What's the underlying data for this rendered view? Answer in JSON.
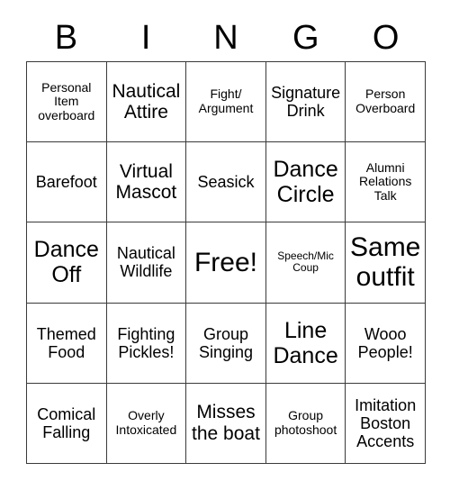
{
  "header": {
    "letters": [
      "B",
      "I",
      "N",
      "G",
      "O"
    ]
  },
  "grid": {
    "rows": 5,
    "columns": 5,
    "cells": [
      {
        "text": "Personal Item overboard",
        "size": "t-sm",
        "name": "bingo-cell-b1"
      },
      {
        "text": "Nautical Attire",
        "size": "t-lg",
        "name": "bingo-cell-i1"
      },
      {
        "text": "Fight/ Argument",
        "size": "t-sm",
        "name": "bingo-cell-n1"
      },
      {
        "text": "Signature Drink",
        "size": "t-md",
        "name": "bingo-cell-g1"
      },
      {
        "text": "Person Overboard",
        "size": "t-sm",
        "name": "bingo-cell-o1"
      },
      {
        "text": "Barefoot",
        "size": "t-md",
        "name": "bingo-cell-b2"
      },
      {
        "text": "Virtual Mascot",
        "size": "t-lg",
        "name": "bingo-cell-i2"
      },
      {
        "text": "Seasick",
        "size": "t-md",
        "name": "bingo-cell-n2"
      },
      {
        "text": "Dance Circle",
        "size": "t-xl",
        "name": "bingo-cell-g2"
      },
      {
        "text": "Alumni Relations Talk",
        "size": "t-sm",
        "name": "bingo-cell-o2"
      },
      {
        "text": "Dance Off",
        "size": "t-xl",
        "name": "bingo-cell-b3"
      },
      {
        "text": "Nautical Wildlife",
        "size": "t-md",
        "name": "bingo-cell-i3"
      },
      {
        "text": "Free!",
        "size": "t-xxl",
        "name": "bingo-cell-free-space"
      },
      {
        "text": "Speech/Mic Coup",
        "size": "t-xs",
        "name": "bingo-cell-g3"
      },
      {
        "text": "Same outfit",
        "size": "t-xxl",
        "name": "bingo-cell-o3"
      },
      {
        "text": "Themed Food",
        "size": "t-md",
        "name": "bingo-cell-b4"
      },
      {
        "text": "Fighting Pickles!",
        "size": "t-md",
        "name": "bingo-cell-i4"
      },
      {
        "text": "Group Singing",
        "size": "t-md",
        "name": "bingo-cell-n4"
      },
      {
        "text": "Line Dance",
        "size": "t-xl",
        "name": "bingo-cell-g4"
      },
      {
        "text": "Wooo People!",
        "size": "t-md",
        "name": "bingo-cell-o4"
      },
      {
        "text": "Comical Falling",
        "size": "t-md",
        "name": "bingo-cell-b5"
      },
      {
        "text": "Overly Intoxicated",
        "size": "t-sm",
        "name": "bingo-cell-i5"
      },
      {
        "text": "Misses the boat",
        "size": "t-lg",
        "name": "bingo-cell-n5"
      },
      {
        "text": "Group photoshoot",
        "size": "t-sm",
        "name": "bingo-cell-g5"
      },
      {
        "text": "Imitation Boston Accents",
        "size": "t-md",
        "name": "bingo-cell-o5"
      }
    ]
  },
  "colors": {
    "background": "#ffffff",
    "text": "#000000",
    "border": "#3a3a3a"
  }
}
